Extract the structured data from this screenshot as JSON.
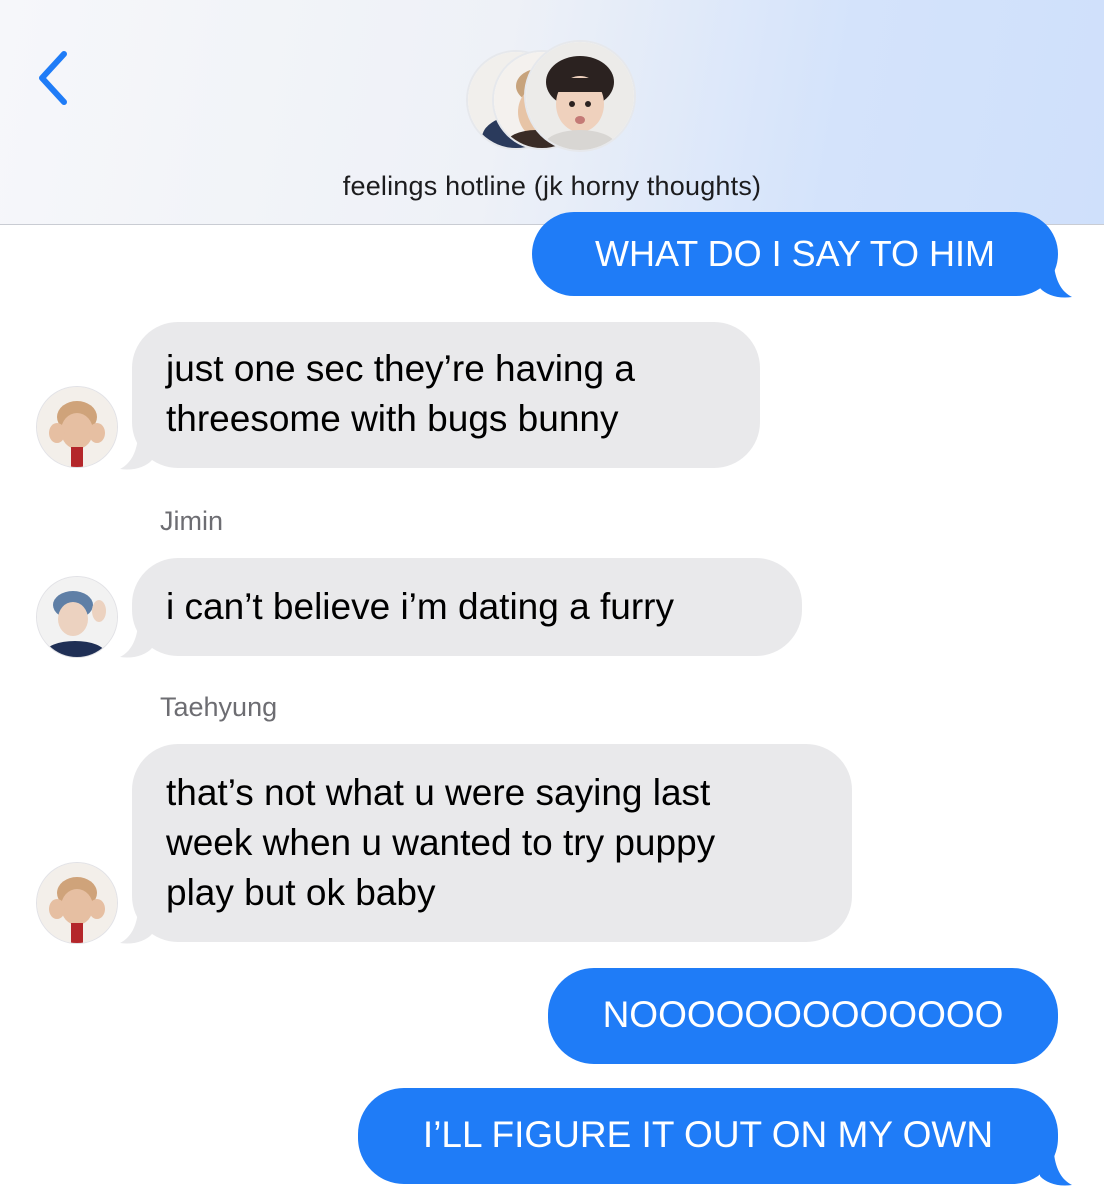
{
  "header": {
    "group_name": "feelings hotline (jk horny thoughts)",
    "back_icon": "chevron-left-icon",
    "accent": "#1f7cf7"
  },
  "colors": {
    "outgoing_bubble": "#1f7cf7",
    "incoming_bubble": "#e9e9eb",
    "sender_name": "#6d6d72"
  },
  "messages": [
    {
      "direction": "outgoing",
      "text": "WHAT DO I SAY TO HIM"
    },
    {
      "direction": "incoming",
      "sender": "",
      "lines": [
        "just one sec they’re having a",
        "threesome with bugs bunny"
      ]
    },
    {
      "direction": "incoming",
      "sender": "Jimin",
      "lines": [
        "i can’t believe i’m dating a furry"
      ]
    },
    {
      "direction": "incoming",
      "sender": "Taehyung",
      "lines": [
        "that’s not what u were saying last",
        "week when u wanted to try puppy",
        "play but ok baby"
      ]
    },
    {
      "direction": "outgoing",
      "text": "NOOOOOOOOOOOOO"
    },
    {
      "direction": "outgoing",
      "text": "I’LL FIGURE IT OUT ON MY OWN"
    }
  ]
}
